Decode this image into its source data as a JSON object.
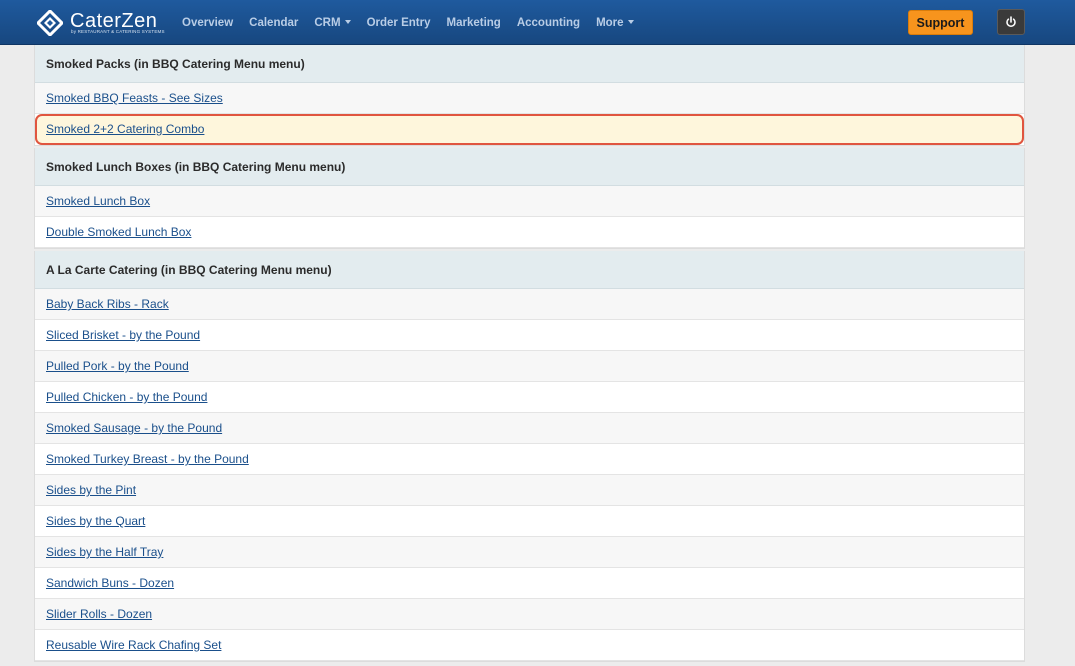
{
  "app": {
    "brand_name": "CaterZen",
    "brand_tagline": "by RESTAURANT & CATERING SYSTEMS"
  },
  "nav": {
    "items": [
      {
        "label": "Overview",
        "dropdown": false
      },
      {
        "label": "Calendar",
        "dropdown": false
      },
      {
        "label": "CRM",
        "dropdown": true
      },
      {
        "label": "Order Entry",
        "dropdown": false
      },
      {
        "label": "Marketing",
        "dropdown": false
      },
      {
        "label": "Accounting",
        "dropdown": false
      },
      {
        "label": "More",
        "dropdown": true
      }
    ],
    "support_label": "Support",
    "power_icon": "power-icon"
  },
  "colors": {
    "topbar": "#1a4f8c",
    "support": "#f7941d",
    "highlight_border": "#e0553f",
    "highlight_fill": "#fef6dc",
    "link": "#1a4f8b"
  },
  "sections": [
    {
      "title": "Smoked Packs (in BBQ Catering Menu menu)",
      "items": [
        {
          "label": "Smoked BBQ Feasts - See Sizes",
          "highlighted": false
        },
        {
          "label": "Smoked 2+2 Catering Combo",
          "highlighted": true
        }
      ]
    },
    {
      "title": "Smoked Lunch Boxes (in BBQ Catering Menu menu)",
      "items": [
        {
          "label": "Smoked Lunch Box",
          "highlighted": false
        },
        {
          "label": "Double Smoked Lunch Box",
          "highlighted": false
        }
      ]
    },
    {
      "title": "A La Carte Catering (in BBQ Catering Menu menu)",
      "items": [
        {
          "label": "Baby Back Ribs - Rack",
          "highlighted": false
        },
        {
          "label": "Sliced Brisket - by the Pound",
          "highlighted": false
        },
        {
          "label": "Pulled Pork - by the Pound",
          "highlighted": false
        },
        {
          "label": "Pulled Chicken - by the Pound",
          "highlighted": false
        },
        {
          "label": "Smoked Sausage - by the Pound",
          "highlighted": false
        },
        {
          "label": "Smoked Turkey Breast - by the Pound",
          "highlighted": false
        },
        {
          "label": "Sides by the Pint",
          "highlighted": false
        },
        {
          "label": "Sides by the Quart",
          "highlighted": false
        },
        {
          "label": "Sides by the Half Tray",
          "highlighted": false
        },
        {
          "label": "Sandwich Buns - Dozen",
          "highlighted": false
        },
        {
          "label": "Slider Rolls - Dozen",
          "highlighted": false
        },
        {
          "label": "Reusable Wire Rack Chafing Set",
          "highlighted": false
        }
      ]
    }
  ]
}
